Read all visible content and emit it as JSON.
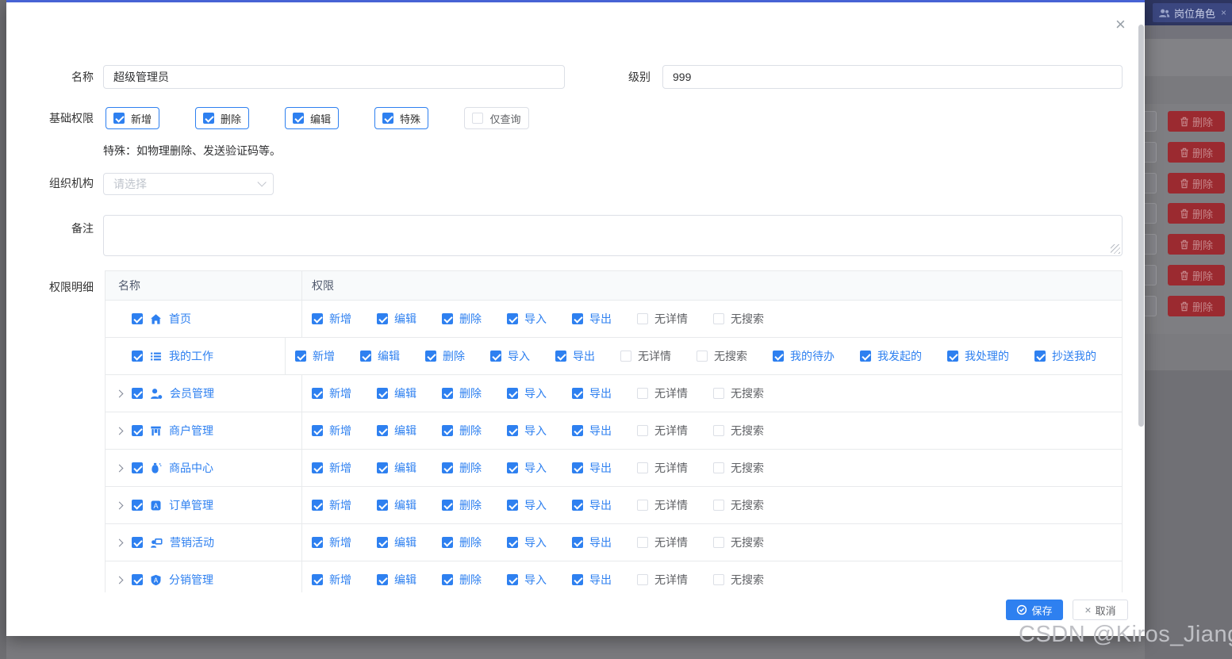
{
  "colors": {
    "primary": "#2e80f0",
    "modal_top_border": "#4763d4",
    "link": "#2e80f0",
    "danger_dimmed": "#9b2a30",
    "tabbar_bg": "#2d3560",
    "tab_bg": "#3b4780",
    "mask_gray": "#7b7b7f"
  },
  "watermark": "CSDN @Kiros_Jiang",
  "background": {
    "tab": {
      "icon": "users-icon",
      "label": "岗位角色",
      "close_icon": "×"
    },
    "delete_button": {
      "icon": "trash-icon",
      "label": "删除",
      "count": 7
    }
  },
  "modal": {
    "close_icon": "×",
    "fields": {
      "name": {
        "label": "名称",
        "value": "超级管理员"
      },
      "level": {
        "label": "级别",
        "value": "999"
      },
      "base_permissions": {
        "label": "基础权限",
        "options": [
          {
            "label": "新增",
            "checked": true
          },
          {
            "label": "删除",
            "checked": true
          },
          {
            "label": "编辑",
            "checked": true
          },
          {
            "label": "特殊",
            "checked": true
          },
          {
            "label": "仅查询",
            "checked": false
          }
        ],
        "note": "特殊：如物理删除、发送验证码等。"
      },
      "organization": {
        "label": "组织机构",
        "placeholder": "请选择"
      },
      "remark": {
        "label": "备注",
        "value": ""
      },
      "permission_detail": {
        "label": "权限明细",
        "columns": [
          "名称",
          "权限"
        ],
        "rows": [
          {
            "name": "首页",
            "icon": "home-icon",
            "expandable": false,
            "checked": true,
            "perms": [
              {
                "label": "新增",
                "checked": true
              },
              {
                "label": "编辑",
                "checked": true
              },
              {
                "label": "删除",
                "checked": true
              },
              {
                "label": "导入",
                "checked": true
              },
              {
                "label": "导出",
                "checked": true
              },
              {
                "label": "无详情",
                "checked": false
              },
              {
                "label": "无搜索",
                "checked": false
              }
            ]
          },
          {
            "name": "我的工作",
            "icon": "list-icon",
            "expandable": false,
            "checked": true,
            "perms": [
              {
                "label": "新增",
                "checked": true
              },
              {
                "label": "编辑",
                "checked": true
              },
              {
                "label": "删除",
                "checked": true
              },
              {
                "label": "导入",
                "checked": true
              },
              {
                "label": "导出",
                "checked": true
              },
              {
                "label": "无详情",
                "checked": false
              },
              {
                "label": "无搜索",
                "checked": false
              },
              {
                "label": "我的待办",
                "checked": true
              },
              {
                "label": "我发起的",
                "checked": true
              },
              {
                "label": "我处理的",
                "checked": true
              },
              {
                "label": "抄送我的",
                "checked": true
              }
            ]
          },
          {
            "name": "会员管理",
            "icon": "member-icon",
            "expandable": true,
            "checked": true,
            "perms": [
              {
                "label": "新增",
                "checked": true
              },
              {
                "label": "编辑",
                "checked": true
              },
              {
                "label": "删除",
                "checked": true
              },
              {
                "label": "导入",
                "checked": true
              },
              {
                "label": "导出",
                "checked": true
              },
              {
                "label": "无详情",
                "checked": false
              },
              {
                "label": "无搜索",
                "checked": false
              }
            ]
          },
          {
            "name": "商户管理",
            "icon": "merchant-icon",
            "expandable": true,
            "checked": true,
            "perms": [
              {
                "label": "新增",
                "checked": true
              },
              {
                "label": "编辑",
                "checked": true
              },
              {
                "label": "删除",
                "checked": true
              },
              {
                "label": "导入",
                "checked": true
              },
              {
                "label": "导出",
                "checked": true
              },
              {
                "label": "无详情",
                "checked": false
              },
              {
                "label": "无搜索",
                "checked": false
              }
            ]
          },
          {
            "name": "商品中心",
            "icon": "product-icon",
            "expandable": true,
            "checked": true,
            "perms": [
              {
                "label": "新增",
                "checked": true
              },
              {
                "label": "编辑",
                "checked": true
              },
              {
                "label": "删除",
                "checked": true
              },
              {
                "label": "导入",
                "checked": true
              },
              {
                "label": "导出",
                "checked": true
              },
              {
                "label": "无详情",
                "checked": false
              },
              {
                "label": "无搜索",
                "checked": false
              }
            ]
          },
          {
            "name": "订单管理",
            "icon": "order-icon",
            "expandable": true,
            "checked": true,
            "perms": [
              {
                "label": "新增",
                "checked": true
              },
              {
                "label": "编辑",
                "checked": true
              },
              {
                "label": "删除",
                "checked": true
              },
              {
                "label": "导入",
                "checked": true
              },
              {
                "label": "导出",
                "checked": true
              },
              {
                "label": "无详情",
                "checked": false
              },
              {
                "label": "无搜索",
                "checked": false
              }
            ]
          },
          {
            "name": "营销活动",
            "icon": "marketing-icon",
            "expandable": true,
            "checked": true,
            "perms": [
              {
                "label": "新增",
                "checked": true
              },
              {
                "label": "编辑",
                "checked": true
              },
              {
                "label": "删除",
                "checked": true
              },
              {
                "label": "导入",
                "checked": true
              },
              {
                "label": "导出",
                "checked": true
              },
              {
                "label": "无详情",
                "checked": false
              },
              {
                "label": "无搜索",
                "checked": false
              }
            ]
          },
          {
            "name": "分销管理",
            "icon": "distribution-icon",
            "expandable": true,
            "checked": true,
            "perms": [
              {
                "label": "新增",
                "checked": true
              },
              {
                "label": "编辑",
                "checked": true
              },
              {
                "label": "删除",
                "checked": true
              },
              {
                "label": "导入",
                "checked": true
              },
              {
                "label": "导出",
                "checked": true
              },
              {
                "label": "无详情",
                "checked": false
              },
              {
                "label": "无搜索",
                "checked": false
              }
            ]
          }
        ]
      }
    },
    "footer": {
      "save_label": "保存",
      "save_icon": "check-circle-icon",
      "cancel_label": "取消",
      "cancel_icon": "×"
    }
  }
}
